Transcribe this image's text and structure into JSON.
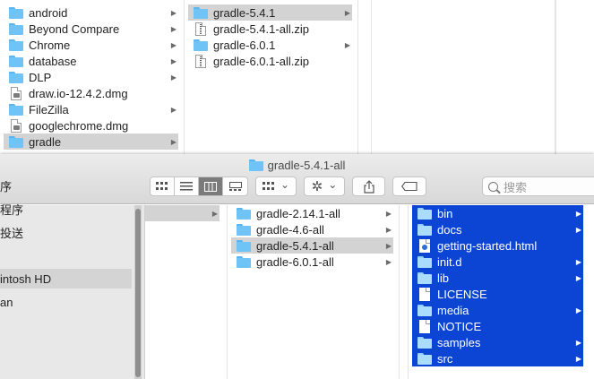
{
  "back_window": {
    "column1": [
      {
        "name": "android",
        "kind": "folder",
        "chevron": true,
        "selected": false
      },
      {
        "name": "Beyond Compare",
        "kind": "folder",
        "chevron": true,
        "selected": false
      },
      {
        "name": "Chrome",
        "kind": "folder",
        "chevron": true,
        "selected": false
      },
      {
        "name": "database",
        "kind": "folder",
        "chevron": true,
        "selected": false
      },
      {
        "name": "DLP",
        "kind": "folder",
        "chevron": true,
        "selected": false
      },
      {
        "name": "draw.io-12.4.2.dmg",
        "kind": "dmg",
        "chevron": false,
        "selected": false
      },
      {
        "name": "FileZilla",
        "kind": "folder",
        "chevron": true,
        "selected": false
      },
      {
        "name": "googlechrome.dmg",
        "kind": "dmg",
        "chevron": false,
        "selected": false
      },
      {
        "name": "gradle",
        "kind": "folder",
        "chevron": true,
        "selected": true
      }
    ],
    "column2": [
      {
        "name": "gradle-5.4.1",
        "kind": "folder",
        "chevron": true,
        "selected": true
      },
      {
        "name": "gradle-5.4.1-all.zip",
        "kind": "zip",
        "chevron": false,
        "selected": false
      },
      {
        "name": "gradle-6.0.1",
        "kind": "folder",
        "chevron": true,
        "selected": false
      },
      {
        "name": "gradle-6.0.1-all.zip",
        "kind": "zip",
        "chevron": false,
        "selected": false
      }
    ]
  },
  "front_window": {
    "title": "gradle-5.4.1-all",
    "search_placeholder": "搜索",
    "toolbar": {
      "view_icons": [
        "icon-view",
        "list-view",
        "column-view",
        "gallery-view"
      ],
      "active_view": 2,
      "group_chevron": "⌄",
      "action_chevron": "⌄"
    },
    "sidebar": [
      {
        "label": "序",
        "selected": false
      },
      {
        "label": "程序",
        "selected": false
      },
      {
        "label": "投送",
        "selected": false
      },
      {
        "label": "intosh HD",
        "selected": true
      },
      {
        "label": "an",
        "selected": false
      }
    ],
    "column2": [
      {
        "name": "gradle-2.14.1-all",
        "kind": "folder",
        "chevron": true,
        "selected": false
      },
      {
        "name": "gradle-4.6-all",
        "kind": "folder",
        "chevron": true,
        "selected": false
      },
      {
        "name": "gradle-5.4.1-all",
        "kind": "folder",
        "chevron": true,
        "selected": true
      },
      {
        "name": "gradle-6.0.1-all",
        "kind": "folder",
        "chevron": true,
        "selected": false
      }
    ],
    "column3": [
      {
        "name": "bin",
        "kind": "folder",
        "chevron": true
      },
      {
        "name": "docs",
        "kind": "folder",
        "chevron": true
      },
      {
        "name": "getting-started.html",
        "kind": "html",
        "chevron": false
      },
      {
        "name": "init.d",
        "kind": "folder",
        "chevron": true
      },
      {
        "name": "lib",
        "kind": "folder",
        "chevron": true
      },
      {
        "name": "LICENSE",
        "kind": "doc",
        "chevron": false
      },
      {
        "name": "media",
        "kind": "folder",
        "chevron": true
      },
      {
        "name": "NOTICE",
        "kind": "doc",
        "chevron": false
      },
      {
        "name": "samples",
        "kind": "folder",
        "chevron": true
      },
      {
        "name": "src",
        "kind": "folder",
        "chevron": true
      }
    ]
  },
  "colors": {
    "selection_blue": "#0c44d4",
    "selection_grey": "#d3d3d3",
    "folder_blue": "#70c3f5"
  }
}
